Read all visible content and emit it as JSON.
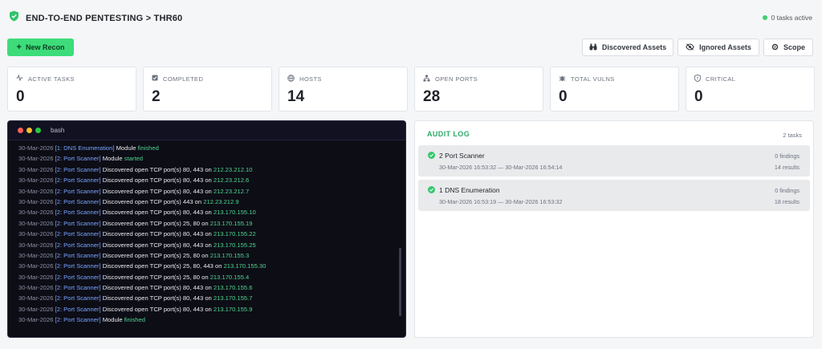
{
  "header": {
    "title": "END-TO-END PENTESTING > THR60",
    "status_text": "0 tasks active"
  },
  "toolbar": {
    "new_recon": "New Recon",
    "discovered_assets": "Discovered Assets",
    "ignored_assets": "Ignored Assets",
    "scope": "Scope"
  },
  "stats": [
    {
      "label": "ACTIVE TASKS",
      "value": "0",
      "icon": "pulse-icon"
    },
    {
      "label": "COMPLETED",
      "value": "2",
      "icon": "check-square-icon"
    },
    {
      "label": "HOSTS",
      "value": "14",
      "icon": "globe-icon"
    },
    {
      "label": "OPEN PORTS",
      "value": "28",
      "icon": "network-icon"
    },
    {
      "label": "TOTAL VULNS",
      "value": "0",
      "icon": "bug-icon"
    },
    {
      "label": "CRITICAL",
      "value": "0",
      "icon": "shield-alert-icon"
    }
  ],
  "terminal": {
    "name": "bash",
    "lines": [
      {
        "date": "30-Mar-2026",
        "module": "[1: DNS Enumeration]",
        "text": "Module",
        "status": "finished"
      },
      {
        "date": "30-Mar-2026",
        "module": "[2: Port Scanner]",
        "text": "Module",
        "status": "started"
      },
      {
        "date": "30-Mar-2026",
        "module": "[2: Port Scanner]",
        "text": "Discovered open TCP port(s) 80, 443 on",
        "ip": "212.23.212.10"
      },
      {
        "date": "30-Mar-2026",
        "module": "[2: Port Scanner]",
        "text": "Discovered open TCP port(s) 80, 443 on",
        "ip": "212.23.212.6"
      },
      {
        "date": "30-Mar-2026",
        "module": "[2: Port Scanner]",
        "text": "Discovered open TCP port(s) 80, 443 on",
        "ip": "212.23.212.7"
      },
      {
        "date": "30-Mar-2026",
        "module": "[2: Port Scanner]",
        "text": "Discovered open TCP port(s) 443 on",
        "ip": "212.23.212.9"
      },
      {
        "date": "30-Mar-2026",
        "module": "[2: Port Scanner]",
        "text": "Discovered open TCP port(s) 80, 443 on",
        "ip": "213.170.155.10"
      },
      {
        "date": "30-Mar-2026",
        "module": "[2: Port Scanner]",
        "text": "Discovered open TCP port(s) 25, 80 on",
        "ip": "213.170.155.19"
      },
      {
        "date": "30-Mar-2026",
        "module": "[2: Port Scanner]",
        "text": "Discovered open TCP port(s) 80, 443 on",
        "ip": "213.170.155.22"
      },
      {
        "date": "30-Mar-2026",
        "module": "[2: Port Scanner]",
        "text": "Discovered open TCP port(s) 80, 443 on",
        "ip": "213.170.155.25"
      },
      {
        "date": "30-Mar-2026",
        "module": "[2: Port Scanner]",
        "text": "Discovered open TCP port(s) 25, 80 on",
        "ip": "213.170.155.3"
      },
      {
        "date": "30-Mar-2026",
        "module": "[2: Port Scanner]",
        "text": "Discovered open TCP port(s) 25, 80, 443 on",
        "ip": "213.170.155.30"
      },
      {
        "date": "30-Mar-2026",
        "module": "[2: Port Scanner]",
        "text": "Discovered open TCP port(s) 25, 80 on",
        "ip": "213.170.155.4"
      },
      {
        "date": "30-Mar-2026",
        "module": "[2: Port Scanner]",
        "text": "Discovered open TCP port(s) 80, 443 on",
        "ip": "213.170.155.6"
      },
      {
        "date": "30-Mar-2026",
        "module": "[2: Port Scanner]",
        "text": "Discovered open TCP port(s) 80, 443 on",
        "ip": "213.170.155.7"
      },
      {
        "date": "30-Mar-2026",
        "module": "[2: Port Scanner]",
        "text": "Discovered open TCP port(s) 80, 443 on",
        "ip": "213.170.155.9"
      },
      {
        "date": "30-Mar-2026",
        "module": "[2: Port Scanner]",
        "text": "Module",
        "status": "finished"
      }
    ]
  },
  "audit": {
    "title": "AUDIT LOG",
    "count": "2 tasks",
    "tasks": [
      {
        "name": "2 Port Scanner",
        "time": "30-Mar-2026 16:53:32 — 30-Mar-2026 16:54:14",
        "findings": "0 findings",
        "results": "14 results"
      },
      {
        "name": "1 DNS Enumeration",
        "time": "30-Mar-2026 16:53:19 — 30-Mar-2026 16:53:32",
        "findings": "0 findings",
        "results": "18 results"
      }
    ]
  },
  "colors": {
    "accent": "#3ddc7a",
    "terminal_bg": "#0d0d16",
    "module": "#7aa7ff",
    "ip": "#4fd68f"
  }
}
